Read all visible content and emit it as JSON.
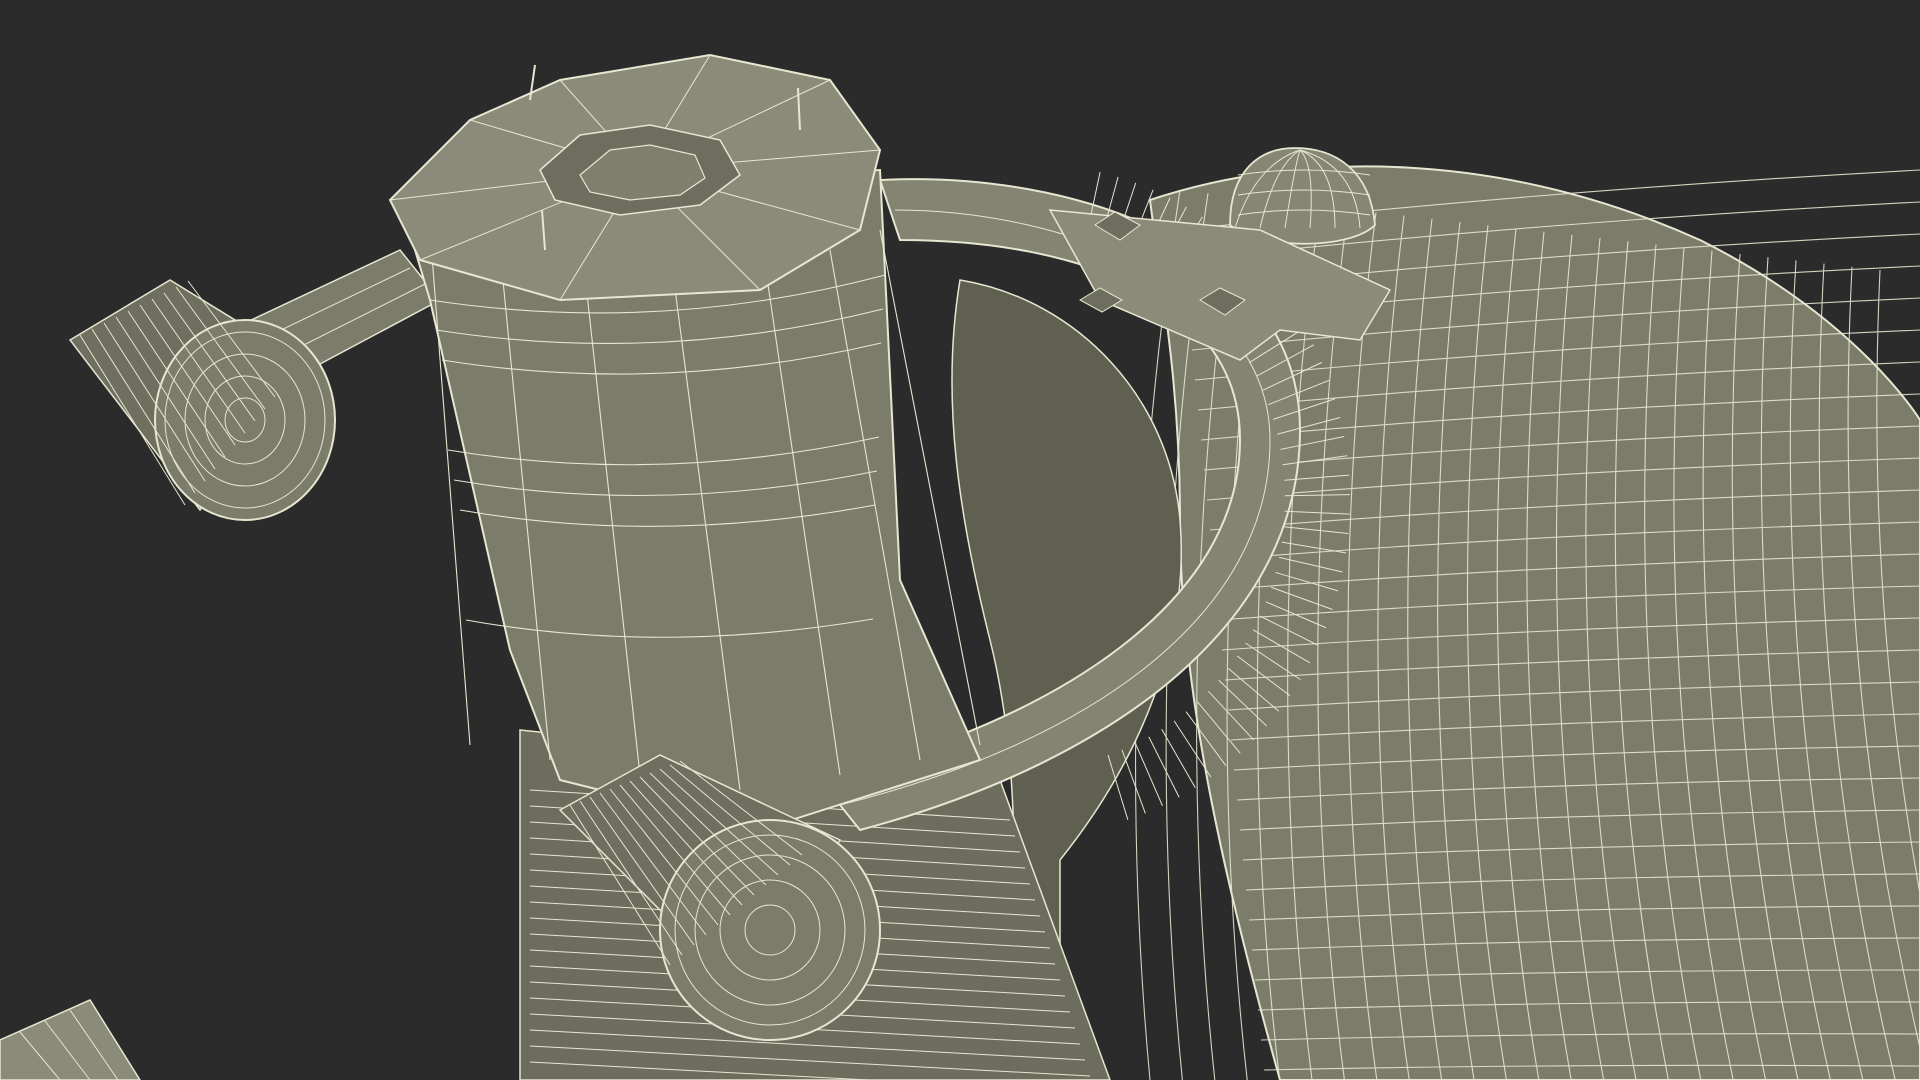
{
  "scene": {
    "background_color": "#2b2b2b",
    "mesh_fill_color": "#7b7c6a",
    "mesh_shade_color": "#5f604f",
    "mesh_dark_color": "#494a3e",
    "wire_color": "#e6e6d2",
    "objects": [
      {
        "name": "cylinder-tower",
        "label": ""
      },
      {
        "name": "curved-ring",
        "label": ""
      },
      {
        "name": "dish-surface",
        "label": ""
      },
      {
        "name": "hub-left",
        "label": ""
      },
      {
        "name": "hub-lower",
        "label": ""
      },
      {
        "name": "dome-cap",
        "label": ""
      }
    ]
  }
}
